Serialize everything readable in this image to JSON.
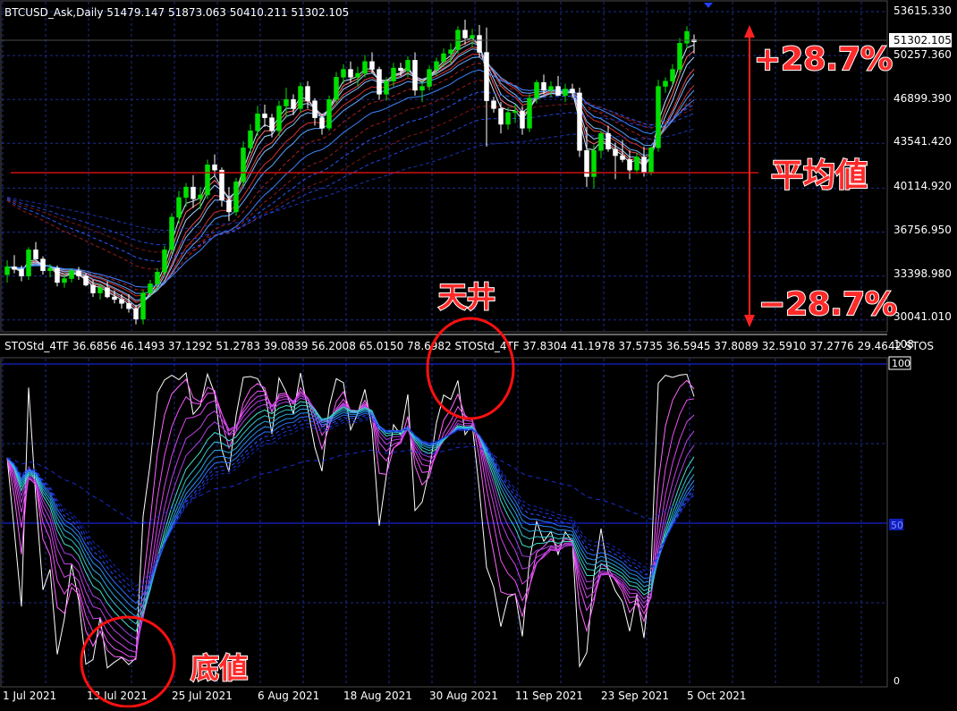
{
  "header": {
    "main_info": "BTCUSD_Ask,Daily  51479.147 51873.063 50410.211 51302.105",
    "osc_info": "STOStd_4TF 36.6856 46.1493 37.1292 51.2783 39.0839 56.2008 65.0150 78.6982  STOStd_4TF 37.8304 41.1978 37.5735 36.5945 37.8089 32.5910 37.2776 29.4642   STOS"
  },
  "price_axis": {
    "labels": [
      "53615.330",
      "50257.360",
      "46899.390",
      "43541.420",
      "40114.920",
      "36756.950",
      "33398.980",
      "30041.010"
    ],
    "current_label": "51302.105"
  },
  "osc_axis": {
    "top_label": "108",
    "level_100": "100",
    "level_50": "50",
    "bottom_label": "0"
  },
  "date_axis": {
    "labels": [
      "1 Jul 2021",
      "13 Jul 2021",
      "25 Jul 2021",
      "6 Aug 2021",
      "18 Aug 2021",
      "30 Aug 2021",
      "11 Sep 2021",
      "23 Sep 2021",
      "5 Oct 2021"
    ]
  },
  "annotations": {
    "up_pct": "+28.7%",
    "average": "平均値",
    "down_pct": "−28.7%",
    "ceiling": "天井",
    "bottom": "底値"
  },
  "colors": {
    "bull": "#00e000",
    "bear": "#ffffff",
    "grid": "#1e2c8c",
    "avg_line": "#d01010",
    "annotation": "#ff2a2a"
  },
  "chart_data": {
    "type": "candlestick",
    "symbol": "BTCUSD_Ask",
    "timeframe": "Daily",
    "current": {
      "open": 51479.147,
      "high": 51873.063,
      "low": 50410.211,
      "close": 51302.105
    },
    "average_level": 41300,
    "ylim": [
      29200,
      54300
    ],
    "candles": [
      [
        33500,
        34600,
        32900,
        34100
      ],
      [
        34100,
        35000,
        33600,
        33900
      ],
      [
        33900,
        34200,
        33000,
        33400
      ],
      [
        33400,
        35600,
        33100,
        35400
      ],
      [
        35400,
        36000,
        34800,
        34700
      ],
      [
        34700,
        34900,
        33500,
        33800
      ],
      [
        33800,
        34300,
        33300,
        34000
      ],
      [
        34000,
        34200,
        32600,
        32900
      ],
      [
        32900,
        33500,
        32500,
        33200
      ],
      [
        33200,
        34000,
        32900,
        33800
      ],
      [
        33800,
        34100,
        33100,
        33400
      ],
      [
        33400,
        33600,
        32600,
        32700
      ],
      [
        32700,
        33100,
        31800,
        32100
      ],
      [
        32100,
        32800,
        31600,
        32500
      ],
      [
        32500,
        33000,
        31700,
        31800
      ],
      [
        31800,
        32300,
        31300,
        31600
      ],
      [
        31600,
        32000,
        30900,
        31300
      ],
      [
        31300,
        32000,
        30600,
        30900
      ],
      [
        30900,
        31200,
        29700,
        30100
      ],
      [
        30100,
        32300,
        29700,
        32100
      ],
      [
        32100,
        33100,
        31800,
        32800
      ],
      [
        32800,
        34000,
        32300,
        33700
      ],
      [
        33700,
        35700,
        33400,
        35400
      ],
      [
        35400,
        38200,
        35100,
        37900
      ],
      [
        37900,
        39900,
        37400,
        39400
      ],
      [
        39400,
        40500,
        38700,
        40200
      ],
      [
        40200,
        41100,
        38600,
        39300
      ],
      [
        39300,
        40200,
        38500,
        39600
      ],
      [
        39600,
        42300,
        39300,
        41900
      ],
      [
        41900,
        42700,
        41000,
        41500
      ],
      [
        41500,
        41700,
        38700,
        39200
      ],
      [
        39200,
        40200,
        37600,
        38300
      ],
      [
        38300,
        40900,
        38000,
        40600
      ],
      [
        40600,
        43700,
        40300,
        43200
      ],
      [
        43200,
        45000,
        42800,
        44500
      ],
      [
        44500,
        46400,
        44100,
        45800
      ],
      [
        45800,
        46500,
        44800,
        45500
      ],
      [
        45500,
        45800,
        44000,
        44500
      ],
      [
        44500,
        46800,
        44100,
        46400
      ],
      [
        46400,
        47800,
        45600,
        46900
      ],
      [
        46900,
        47300,
        45700,
        46200
      ],
      [
        46200,
        48200,
        45900,
        47900
      ],
      [
        47900,
        48300,
        46200,
        46800
      ],
      [
        46800,
        47000,
        44900,
        45500
      ],
      [
        45500,
        45800,
        44200,
        44700
      ],
      [
        44700,
        47200,
        44500,
        46900
      ],
      [
        46900,
        49000,
        46600,
        48600
      ],
      [
        48600,
        49600,
        48100,
        49200
      ],
      [
        49200,
        49800,
        48200,
        48600
      ],
      [
        48600,
        49400,
        47900,
        48900
      ],
      [
        48900,
        50300,
        48600,
        49800
      ],
      [
        49800,
        50500,
        48900,
        49200
      ],
      [
        49200,
        49400,
        46900,
        47300
      ],
      [
        47300,
        48600,
        46800,
        48300
      ],
      [
        48300,
        49700,
        47900,
        49300
      ],
      [
        49300,
        49700,
        48700,
        49100
      ],
      [
        49100,
        50200,
        48600,
        49900
      ],
      [
        49900,
        50500,
        47200,
        47600
      ],
      [
        47600,
        48400,
        46700,
        47900
      ],
      [
        47900,
        49500,
        47600,
        49200
      ],
      [
        49200,
        50100,
        48700,
        49800
      ],
      [
        49800,
        50800,
        49400,
        50400
      ],
      [
        50400,
        51200,
        49600,
        50700
      ],
      [
        50700,
        52500,
        50400,
        52200
      ],
      [
        52200,
        53000,
        51100,
        51600
      ],
      [
        51600,
        52300,
        50900,
        51800
      ],
      [
        51800,
        52600,
        50100,
        50500
      ],
      [
        50500,
        52400,
        43300,
        46800
      ],
      [
        46800,
        47100,
        45900,
        46200
      ],
      [
        46200,
        46700,
        44300,
        45000
      ],
      [
        45000,
        46300,
        44600,
        45900
      ],
      [
        45900,
        46500,
        45100,
        46000
      ],
      [
        46000,
        46400,
        44200,
        44700
      ],
      [
        44700,
        47300,
        44400,
        47000
      ],
      [
        47000,
        48400,
        46600,
        48200
      ],
      [
        48200,
        48800,
        47300,
        47600
      ],
      [
        47600,
        48300,
        47100,
        47900
      ],
      [
        47900,
        48700,
        47400,
        47200
      ],
      [
        47200,
        48100,
        46700,
        47700
      ],
      [
        47700,
        48100,
        47000,
        47400
      ],
      [
        47400,
        47800,
        42500,
        43000
      ],
      [
        43000,
        44800,
        40200,
        41000
      ],
      [
        41000,
        43400,
        40100,
        43000
      ],
      [
        43000,
        44500,
        42400,
        44300
      ],
      [
        44300,
        44900,
        42900,
        43100
      ],
      [
        43100,
        43600,
        40800,
        42600
      ],
      [
        42600,
        43800,
        42100,
        42300
      ],
      [
        42300,
        43000,
        40800,
        41500
      ],
      [
        41500,
        42800,
        41200,
        42500
      ],
      [
        42500,
        43300,
        41000,
        41300
      ],
      [
        41300,
        43300,
        41100,
        43200
      ],
      [
        43200,
        48400,
        42900,
        47900
      ],
      [
        47900,
        48600,
        47400,
        48300
      ],
      [
        48300,
        49600,
        48000,
        49200
      ],
      [
        49200,
        51600,
        48800,
        51200
      ],
      [
        51200,
        52500,
        50800,
        52100
      ],
      [
        51479.147,
        51873.063,
        50410.211,
        51302.105
      ]
    ],
    "oscillator": {
      "name": "STOStd_4TF",
      "ylim": [
        0,
        108
      ],
      "levels": [
        50,
        100
      ],
      "values_group1": [
        36.6856,
        46.1493,
        37.1292,
        51.2783,
        39.0839,
        56.2008,
        65.015,
        78.6982
      ],
      "values_group2": [
        37.8304,
        41.1978,
        37.5735,
        36.5945,
        37.8089,
        32.591,
        37.2776,
        29.4642
      ]
    }
  }
}
